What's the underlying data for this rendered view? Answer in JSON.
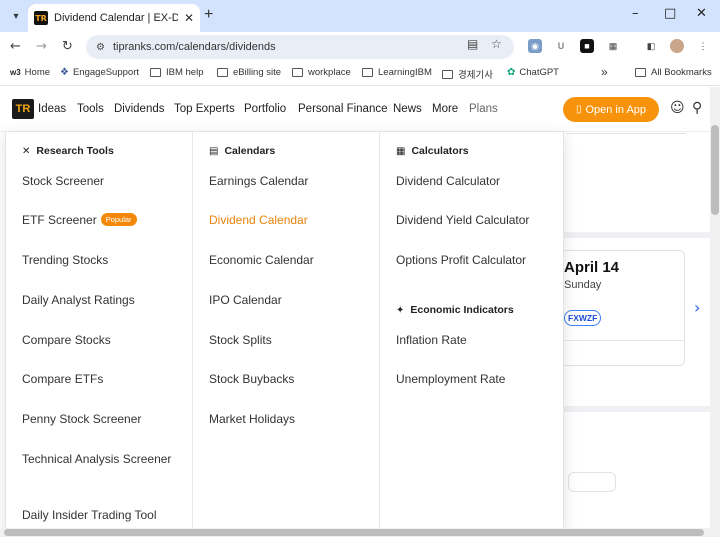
{
  "browser": {
    "tab_title": "Dividend Calendar | EX-Dividen",
    "url": "tipranks.com/calendars/dividends",
    "favicon_text": "TR",
    "new_tab_icon": "+",
    "bookmarks": [
      {
        "label": "Home",
        "icon": "w3"
      },
      {
        "label": "EngageSupport",
        "icon": "engage-icon"
      },
      {
        "label": "IBM help",
        "icon": "folder-icon"
      },
      {
        "label": "eBilling site",
        "icon": "folder-icon"
      },
      {
        "label": "workplace",
        "icon": "folder-icon"
      },
      {
        "label": "LearningIBM",
        "icon": "folder-icon"
      },
      {
        "label": "경제기사",
        "icon": "folder-icon"
      },
      {
        "label": "ChatGPT",
        "icon": "chatgpt-icon"
      }
    ],
    "bookmarks_overflow": "»",
    "all_bookmarks": "All Bookmarks"
  },
  "site": {
    "logo_text": "TR",
    "nav": [
      "Ideas",
      "Tools",
      "Dividends",
      "Top Experts",
      "Portfolio",
      "Personal Finance",
      "News",
      "More",
      "Plans"
    ],
    "open_app_label": "Open in App"
  },
  "menu": {
    "research_tools": {
      "heading": "Research Tools",
      "items": [
        "Stock Screener",
        "ETF Screener",
        "Trending Stocks",
        "Daily Analyst Ratings",
        "Compare Stocks",
        "Compare ETFs",
        "Penny Stock Screener",
        "Technical Analysis Screener",
        "Daily Insider Trading Tool"
      ],
      "popular_badge": "Popular"
    },
    "calendars": {
      "heading": "Calendars",
      "items": [
        "Earnings Calendar",
        "Dividend Calendar",
        "Economic Calendar",
        "IPO Calendar",
        "Stock Splits",
        "Stock Buybacks",
        "Market Holidays"
      ],
      "active_index": 1
    },
    "calculators": {
      "heading": "Calculators",
      "items": [
        "Dividend Calculator",
        "Dividend Yield Calculator",
        "Options Profit Calculator"
      ]
    },
    "economic_indicators": {
      "heading": "Economic Indicators",
      "items": [
        "Inflation Rate",
        "Unemployment Rate"
      ]
    }
  },
  "background": {
    "date": "April 14",
    "day": "Sunday",
    "ticker": "FXWZF"
  },
  "colors": {
    "accent": "#f7930a",
    "active_link": "#e8830c",
    "ticker_blue": "#1d4ed8"
  }
}
